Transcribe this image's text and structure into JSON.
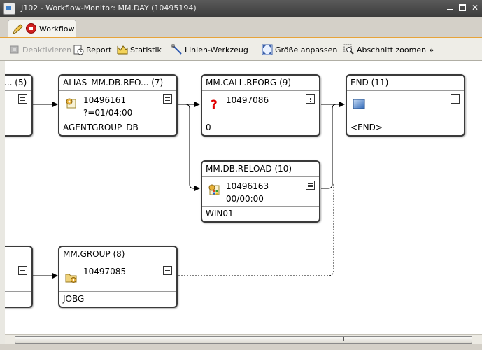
{
  "window": {
    "title": "J102 - Workflow-Monitor: MM.DAY (10495194)"
  },
  "tab": {
    "label": "Workflow"
  },
  "toolbar": {
    "deactivate": "Deaktivieren",
    "report": "Report",
    "statistics": "Statistik",
    "line_tool": "Linien-Werkzeug",
    "fit_size": "Größe anpassen",
    "zoom_section": "Abschnitt zoomen",
    "more": "»"
  },
  "colors": {
    "accent_line": "#e7a33a",
    "titlebar": "#3c3c3c",
    "error_icon": "#e00000"
  },
  "nodes": {
    "n5": {
      "title": "... (5)",
      "run": "",
      "sub": "",
      "foot": ""
    },
    "n7": {
      "title": "ALIAS_MM.DB.REO... (7)",
      "icon": "gear-job-icon",
      "run": "10496161",
      "sub": "?=01/04:00",
      "foot": "AGENTGROUP_DB"
    },
    "n9": {
      "title": "MM.CALL.REORG (9)",
      "icon": "question-icon",
      "run": "10497086",
      "sub": "",
      "foot": "0"
    },
    "n11": {
      "title": "END (11)",
      "icon": "end-icon",
      "run": "",
      "sub": "",
      "foot": "<END>"
    },
    "n10": {
      "title": "MM.DB.RELOAD (10)",
      "icon": "windows-job-icon",
      "run": "10496163",
      "sub": "00/00:00",
      "foot": "WIN01"
    },
    "n8": {
      "title": "MM.GROUP (8)",
      "icon": "folder-group-icon",
      "run": "10497085",
      "sub": "",
      "foot": "JOBG"
    },
    "nleft2": {
      "title": "",
      "run": "",
      "sub": "",
      "foot": ""
    }
  },
  "scrollbar": {
    "grip": "|||"
  }
}
